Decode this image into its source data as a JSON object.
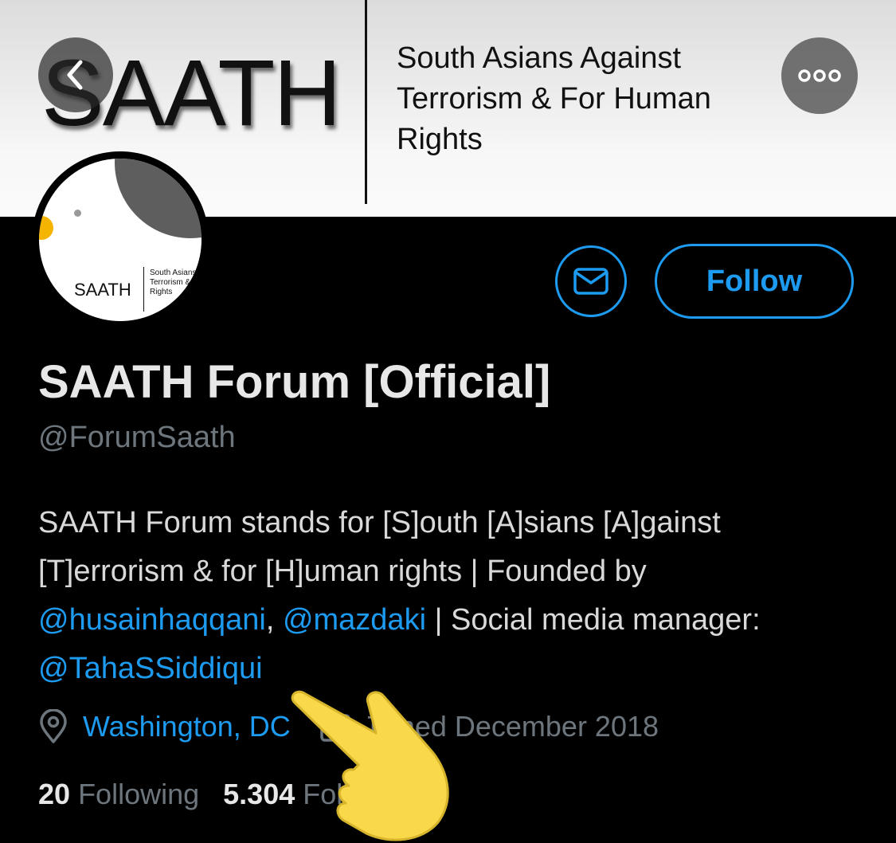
{
  "banner": {
    "logo_text": "SAATH",
    "tagline": "South Asians Against Terrorism & For Human Rights"
  },
  "avatar": {
    "name": "SAATH",
    "small_text": "South Asians\nTerrorism &\nRights"
  },
  "nav": {
    "back_icon": "chevron-left-icon",
    "more_icon": "more-horizontal-icon"
  },
  "actions": {
    "message_icon": "mail-icon",
    "follow_label": "Follow"
  },
  "profile": {
    "display_name": "SAATH Forum [Official]",
    "handle": "@ForumSaath",
    "bio": {
      "p1": "SAATH Forum stands for [S]outh [A]sians [A]gainst [T]errorism & for [H]uman rights | Founded by ",
      "mention1": "@husainhaqqani",
      "p2": ", ",
      "mention2": "@mazdaki",
      "p3": " | Social media manager: ",
      "mention3": "@TahaSSiddiqui"
    },
    "location": "Washington, DC",
    "joined": "Joined December 2018"
  },
  "stats": {
    "following_count": "20",
    "following_label": "Following",
    "followers_count": "5.304",
    "followers_label": "Followers"
  },
  "colors": {
    "accent": "#1d9bf0",
    "muted": "#6e767d",
    "emoji": "#f9d84a"
  }
}
